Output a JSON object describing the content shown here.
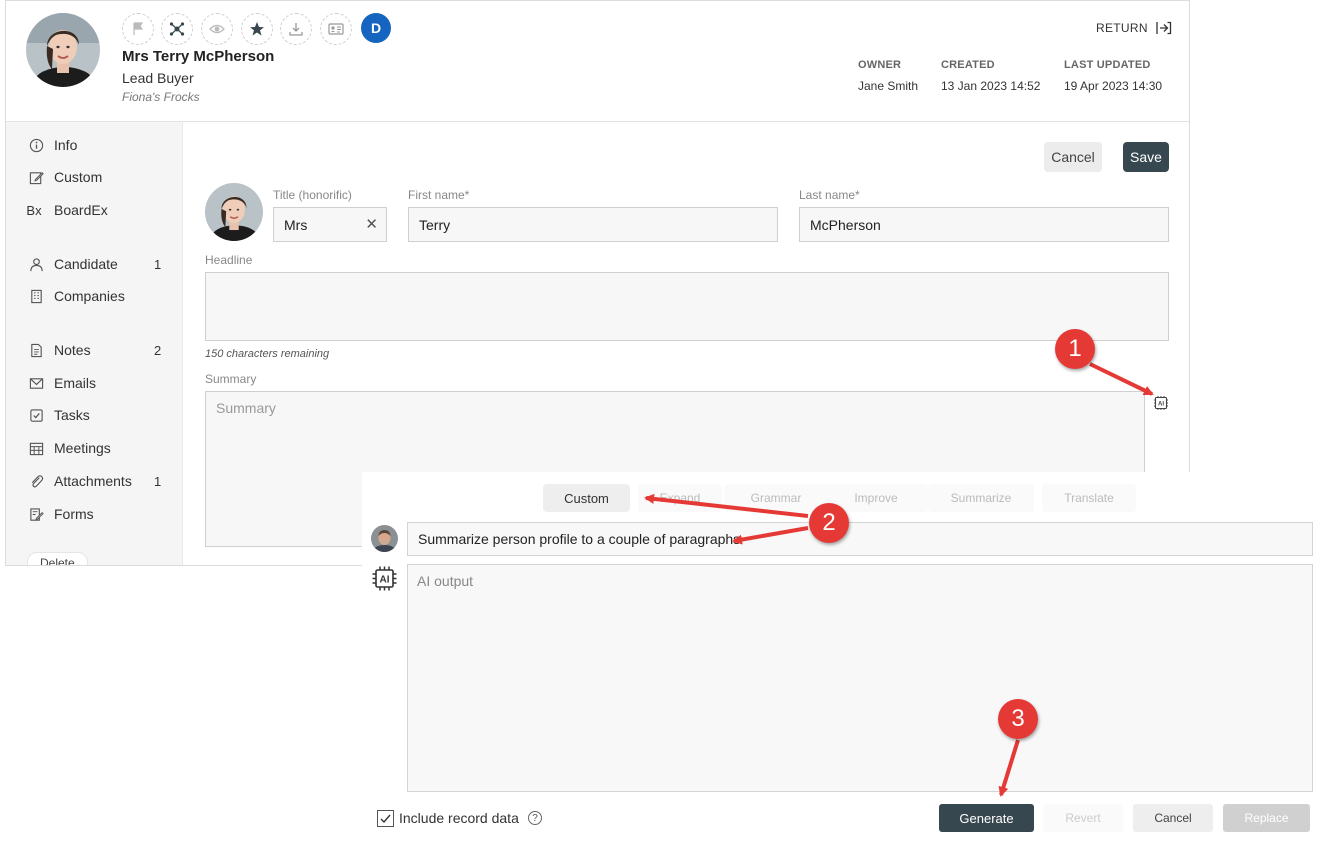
{
  "header": {
    "name": "Mrs Terry McPherson",
    "role": "Lead Buyer",
    "company": "Fiona's Frocks",
    "badge_initial": "D",
    "return_label": "RETURN",
    "owner_label": "OWNER",
    "owner_value": "Jane Smith",
    "created_label": "CREATED",
    "created_value": "13 Jan 2023 14:52",
    "updated_label": "LAST UPDATED",
    "updated_value": "19 Apr 2023 14:30",
    "action_icons": [
      "flag-icon",
      "network-icon",
      "eye-icon",
      "star-icon",
      "download-icon",
      "id-card-icon"
    ]
  },
  "sidebar": {
    "items": [
      {
        "label": "Info",
        "icon": "info-icon",
        "count": ""
      },
      {
        "label": "Custom",
        "icon": "edit-icon",
        "count": ""
      },
      {
        "label": "BoardEx",
        "icon": "Bx",
        "count": ""
      },
      {
        "label": "Candidate",
        "icon": "person-icon",
        "count": "1"
      },
      {
        "label": "Companies",
        "icon": "building-icon",
        "count": ""
      },
      {
        "label": "Notes",
        "icon": "note-icon",
        "count": "2"
      },
      {
        "label": "Emails",
        "icon": "envelope-icon",
        "count": ""
      },
      {
        "label": "Tasks",
        "icon": "checkbox-icon",
        "count": ""
      },
      {
        "label": "Meetings",
        "icon": "calendar-icon",
        "count": ""
      },
      {
        "label": "Attachments",
        "icon": "paperclip-icon",
        "count": "1"
      },
      {
        "label": "Forms",
        "icon": "form-icon",
        "count": ""
      }
    ],
    "delete_label": "Delete"
  },
  "form": {
    "cancel_label": "Cancel",
    "save_label": "Save",
    "title_label": "Title (honorific)",
    "title_value": "Mrs",
    "first_name_label": "First name*",
    "first_name_value": "Terry",
    "last_name_label": "Last name*",
    "last_name_value": "McPherson",
    "headline_label": "Headline",
    "headline_value": "",
    "headline_hint": "150 characters remaining",
    "summary_label": "Summary",
    "summary_placeholder": "Summary"
  },
  "ai_panel": {
    "tabs": [
      "Custom",
      "Expand",
      "Grammar",
      "Improve",
      "Summarize",
      "Translate"
    ],
    "active_tab": "Custom",
    "prompt_value": "Summarize person profile to a couple of paragraphs",
    "output_placeholder": "AI output",
    "include_label": "Include record data",
    "include_checked": true,
    "generate_label": "Generate",
    "revert_label": "Revert",
    "cancel_label": "Cancel",
    "replace_label": "Replace"
  },
  "annotations": [
    "1",
    "2",
    "3"
  ],
  "colors": {
    "accent_dark": "#37474f",
    "badge_blue": "#1565c0",
    "callout_red": "#e53935"
  }
}
